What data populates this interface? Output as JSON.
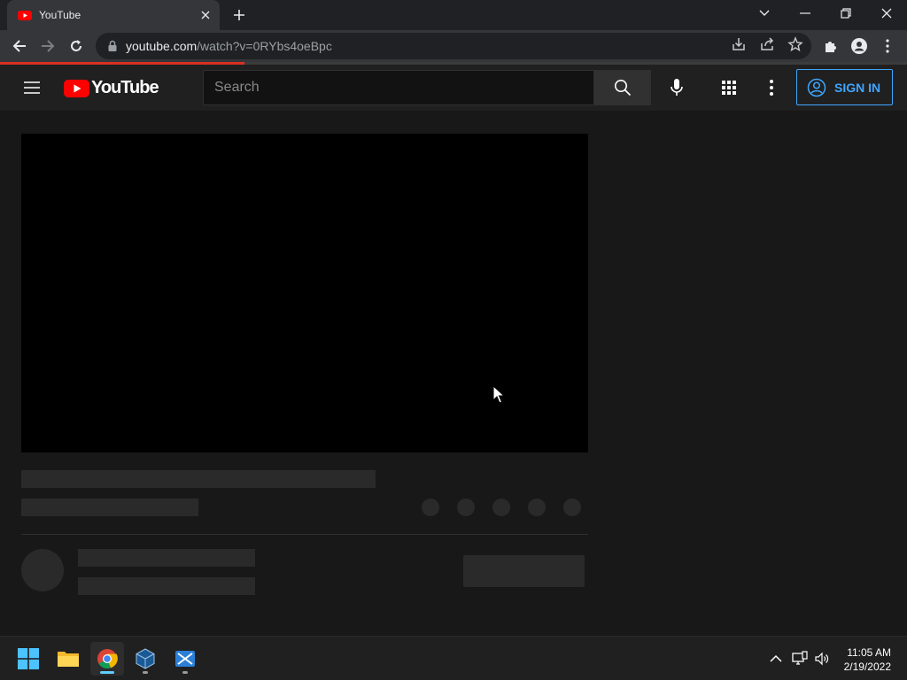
{
  "browser": {
    "tab_title": "YouTube",
    "url_host": "youtube.com",
    "url_path": "/watch?v=0RYbs4oeBpc",
    "load_progress": 0.27
  },
  "youtube": {
    "logo_text": "YouTube",
    "search_placeholder": "Search",
    "signin_label": "SIGN IN"
  },
  "taskbar": {
    "time": "11:05 AM",
    "date": "2/19/2022"
  },
  "colors": {
    "yt_red": "#ff0000",
    "signin_blue": "#3ea6ff",
    "progress_red": "#d93025"
  }
}
